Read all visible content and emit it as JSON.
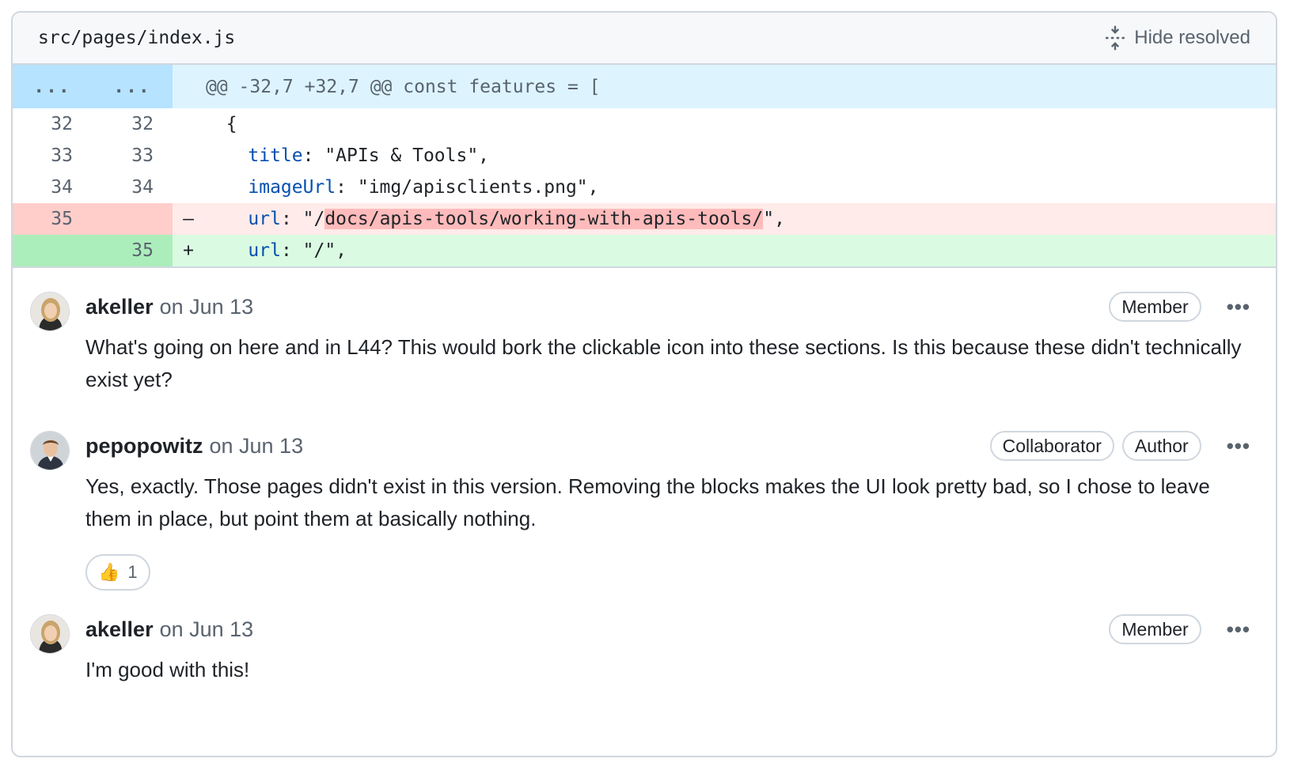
{
  "file": {
    "path": "src/pages/index.js",
    "hide_resolved_label": "Hide resolved"
  },
  "diff": {
    "hunk": {
      "old": "...",
      "new": "...",
      "text": "@@ -32,7 +32,7 @@ const features = ["
    },
    "lines": [
      {
        "type": "context",
        "old": "32",
        "new": "32",
        "sign": "",
        "code": "  {"
      },
      {
        "type": "context",
        "old": "33",
        "new": "33",
        "sign": "",
        "key": "    title",
        "rest": ": \"APIs & Tools\","
      },
      {
        "type": "context",
        "old": "34",
        "new": "34",
        "sign": "",
        "key": "    imageUrl",
        "rest": ": \"img/apisclients.png\","
      },
      {
        "type": "del",
        "old": "35",
        "new": "",
        "sign": "–",
        "key": "    url",
        "pre": ": \"/",
        "highlight": "docs/apis-tools/working-with-apis-tools/",
        "post": "\","
      },
      {
        "type": "add",
        "old": "",
        "new": "35",
        "sign": "+",
        "key": "    url",
        "rest": ": \"/\","
      }
    ]
  },
  "comments": [
    {
      "author": "akeller",
      "date": "on Jun 13",
      "badges": [
        "Member"
      ],
      "body": "What's going on here and in L44? This would bork the clickable icon into these sections. Is this because these didn't technically exist yet?"
    },
    {
      "author": "pepopowitz",
      "date": "on Jun 13",
      "badges": [
        "Collaborator",
        "Author"
      ],
      "body": "Yes, exactly. Those pages didn't exist in this version. Removing the blocks makes the UI look pretty bad, so I chose to leave them in place, but point them at basically nothing.",
      "reaction": {
        "emoji": "👍",
        "count": "1"
      }
    },
    {
      "author": "akeller",
      "date": "on Jun 13",
      "badges": [
        "Member"
      ],
      "body": "I'm good with this!"
    }
  ],
  "kebab_label": "•••",
  "colors": {
    "hunk_bg": "#ddf4ff",
    "del_bg": "#ffebe9",
    "add_bg": "#dafbe1",
    "key_blue": "#0550ae"
  }
}
